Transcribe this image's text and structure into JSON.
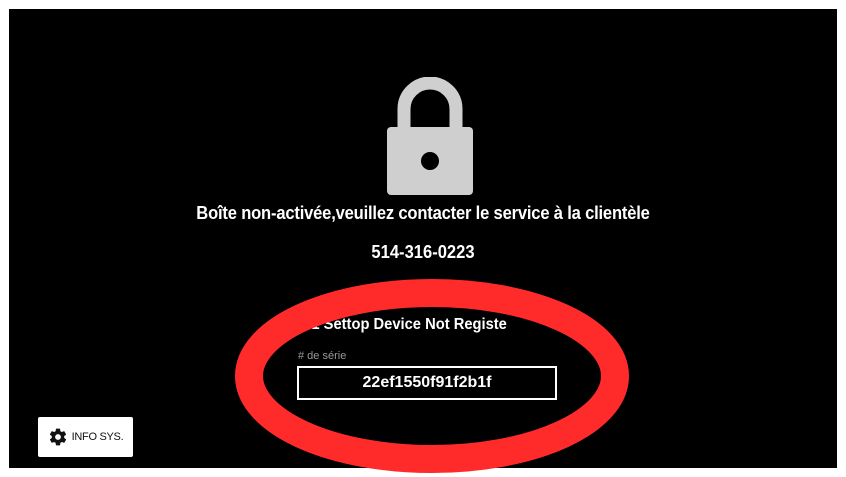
{
  "screen": {
    "message": "Boîte non-activée,veuillez contacter le service à la clientèle",
    "phone": "514-316-0223",
    "error": "901 Settop Device Not Registe",
    "serial_label": "# de série",
    "serial_value": "22ef1550f91f2b1f"
  },
  "info_button": {
    "label": "INFO SYS.",
    "icon": "gear-icon"
  },
  "lock": {
    "icon": "lock-icon"
  },
  "colors": {
    "background": "#000000",
    "lock": "#cfcfcf",
    "annotation": "#ff2b2b",
    "text": "#ffffff"
  }
}
